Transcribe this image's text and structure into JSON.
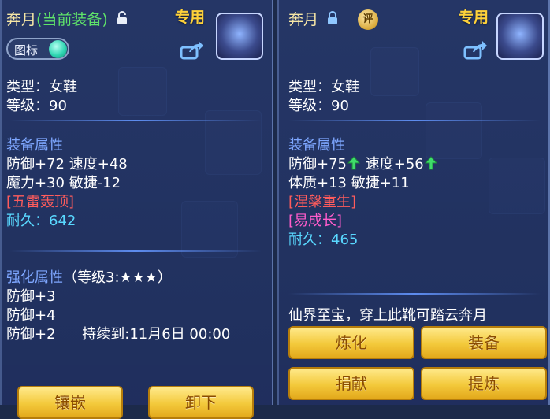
{
  "left": {
    "name": "奔月",
    "equipped_tag": "(当前装备)",
    "exclusive": "专用",
    "toggle_label": "图标",
    "type_line": "类型：女鞋",
    "level_line": "等级：90",
    "section_attr": "装备属性",
    "attr1": "防御+72 速度+48",
    "attr2": "魔力+30 敏捷-12",
    "special": "[五雷轰顶]",
    "durability_label": "耐久：",
    "durability_value": "642",
    "section_enhance": "强化属性",
    "enhance_level": "（等级3:★★★）",
    "enhance1": "防御+3",
    "enhance2": "防御+4",
    "enhance3": "防御+2",
    "enhance3_duration": "持续到:11月6日 00:00",
    "btn1": "镶嵌",
    "btn2": "卸下"
  },
  "right": {
    "name": "奔月",
    "badge": "评",
    "exclusive": "专用",
    "type_line": "类型：女鞋",
    "level_line": "等级：90",
    "section_attr": "装备属性",
    "def": "防御+75",
    "spd": "速度+56",
    "attr2": "体质+13 敏捷+11",
    "special1": "[涅槃重生]",
    "special2": "[易成长]",
    "durability_label": "耐久：",
    "durability_value": "465",
    "desc": "仙界至宝，穿上此靴可踏云奔月",
    "btn_refine": "炼化",
    "btn_equip": "装备",
    "btn_donate": "捐献",
    "btn_extract": "提炼"
  },
  "colors": {
    "green": "#5fe36a",
    "section_blue": "#7ea7ff",
    "red": "#ff5c5c",
    "magenta": "#ff5ccb",
    "cyan": "#59d8ff",
    "gold": "#ffd23a"
  },
  "icons": [
    "unlock-icon",
    "lock-icon",
    "share-icon",
    "up-arrow-icon",
    "item-icon"
  ]
}
